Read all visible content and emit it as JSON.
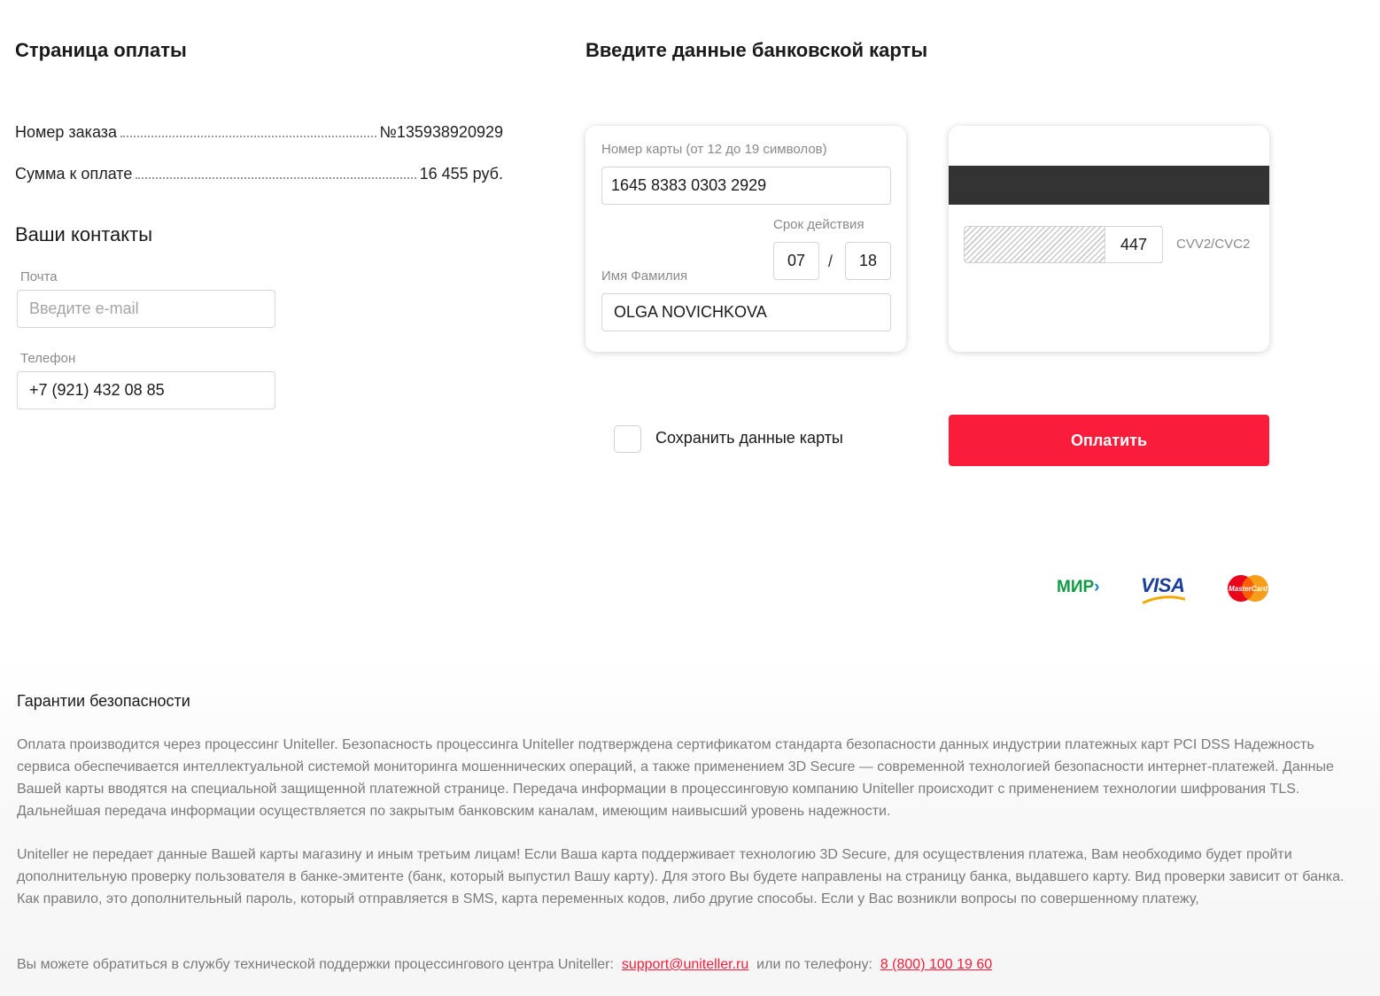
{
  "page": {
    "title": "Страница оплаты",
    "card_section_title": "Введите данные банковской карты"
  },
  "order": {
    "number_label": "Номер заказа",
    "number_value": "№135938920929",
    "sum_label": "Сумма к оплате",
    "sum_value": "16 455 руб."
  },
  "contacts": {
    "title": "Ваши контакты",
    "email_label": "Почта",
    "email_placeholder": "Введите e-mail",
    "email_value": "",
    "phone_label": "Телефон",
    "phone_value": "+7 (921) 432 08 85"
  },
  "card": {
    "number_label": "Номер карты (от 12 до 19 символов)",
    "number_value": "1645 8383 0303 2929",
    "expiry_label": "Срок действия",
    "expiry_month": "07",
    "expiry_separator": "/",
    "expiry_year": "18",
    "holder_label": "Имя Фамилия",
    "holder_value": "OLGA NOVICHKOVA",
    "cvv_value": "447",
    "cvv_label": "CVV2/CVC2"
  },
  "actions": {
    "save_card_label": "Сохранить данные карты",
    "save_card_checked": false,
    "pay_button_label": "Оплатить",
    "pay_button_color": "#fa1d3a"
  },
  "payment_logos": {
    "mir": "МИР",
    "visa": "VISA",
    "mastercard": "MasterCard"
  },
  "security": {
    "title": "Гарантии безопасности",
    "paragraph1": "Оплата производится через процессинг Uniteller. Безопасность процессинга Uniteller подтверждена сертификатом стандарта безопасности данных индустрии платежных карт PCI DSS Надежность сервиса обеспечивается интеллектуальной системой мониторинга мошеннических операций, а также применением 3D Secure — современной технологией безопасности интернет-платежей. Данные Вашей карты вводятся на специальной защищенной платежной странице. Передача информации в процессинговую компанию Uniteller происходит с применением технологии шифрования TLS. Дальнейшая передача информации осуществляется по закрытым банковским каналам, имеющим наивысший уровень надежности.",
    "paragraph2": "Uniteller не передает данные Вашей карты магазину и иным третьим лицам! Если Ваша карта поддерживает технологию 3D Secure, для осуществления платежа, Вам необходимо будет пройти дополнительную проверку пользователя в банке-эмитенте (банк, который выпустил Вашу карту). Для этого Вы будете направлены на страницу банка, выдавшего карту. Вид проверки зависит от банка. Как правило, это дополнительный пароль, который отправляется в SMS, карта переменных кодов, либо другие способы. Если у Вас возникли вопросы по совершенному платежу,",
    "support_prefix": "Вы можете обратиться в службу технической поддержки процессингового центра Uniteller:",
    "support_email": "support@uniteller.ru",
    "support_middle": "или по телефону:",
    "support_phone": "8 (800) 100 19 60",
    "link_color": "#fa1d3a"
  }
}
